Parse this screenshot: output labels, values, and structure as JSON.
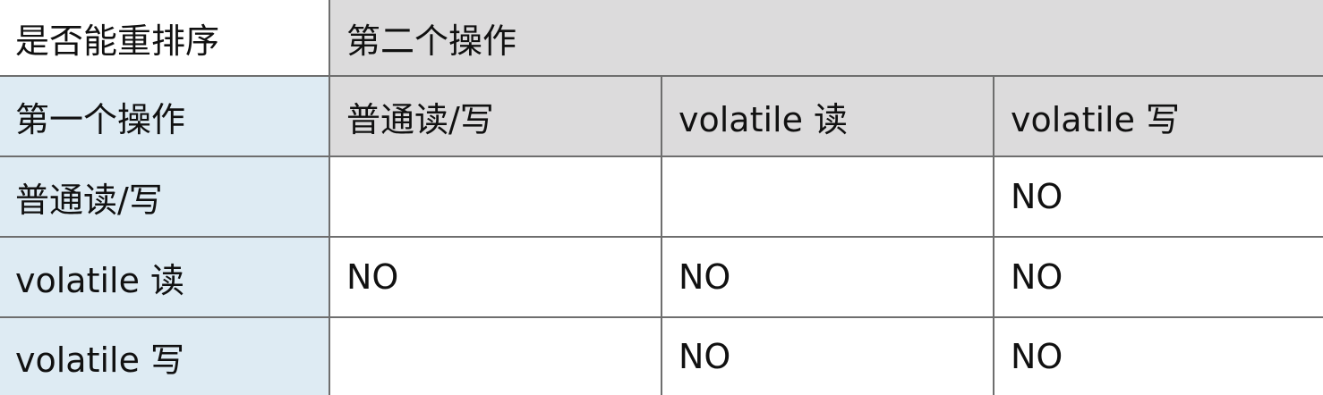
{
  "table": {
    "corner_label": "是否能重排序",
    "second_op_label": "第二个操作",
    "first_op_label": "第一个操作",
    "columns": [
      "普通读/写",
      "volatile 读",
      "volatile 写"
    ],
    "rows": [
      {
        "label": "普通读/写",
        "cells": [
          "",
          "",
          "NO"
        ]
      },
      {
        "label": "volatile 读",
        "cells": [
          "NO",
          "NO",
          "NO"
        ]
      },
      {
        "label": "volatile 写",
        "cells": [
          "",
          "NO",
          "NO"
        ]
      }
    ]
  }
}
